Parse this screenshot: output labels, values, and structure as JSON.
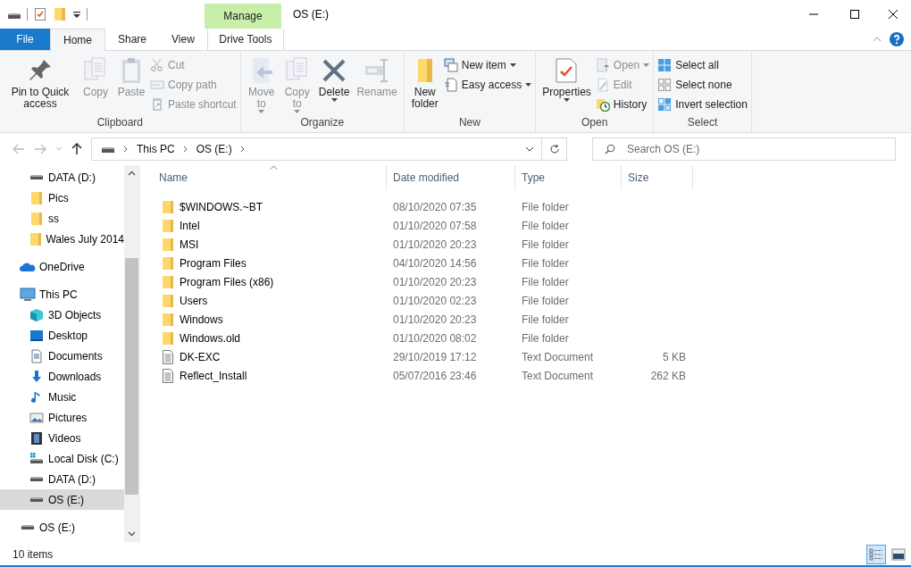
{
  "window": {
    "title": "OS (E:)",
    "contextual_group": "Manage"
  },
  "tabs": [
    {
      "label": "File",
      "kind": "file",
      "selected": false
    },
    {
      "label": "Home",
      "kind": "normal",
      "selected": true
    },
    {
      "label": "Share",
      "kind": "normal",
      "selected": false
    },
    {
      "label": "View",
      "kind": "normal",
      "selected": false
    },
    {
      "label": "Drive Tools",
      "kind": "contextual",
      "selected": false
    }
  ],
  "ribbon": [
    {
      "label": "Clipboard",
      "buttons": [
        {
          "kind": "large",
          "label": "Pin to Quick access",
          "disabled": false,
          "menu": false
        },
        {
          "kind": "large",
          "label": "Copy",
          "disabled": true,
          "menu": false
        },
        {
          "kind": "large",
          "label": "Paste",
          "disabled": true,
          "menu": false
        },
        {
          "kind": "small",
          "label": "Cut",
          "disabled": true,
          "menu": false
        },
        {
          "kind": "small",
          "label": "Copy path",
          "disabled": true,
          "menu": false
        },
        {
          "kind": "small",
          "label": "Paste shortcut",
          "disabled": true,
          "menu": false
        }
      ]
    },
    {
      "label": "Organize",
      "buttons": [
        {
          "kind": "large",
          "label": "Move to",
          "disabled": true,
          "menu": true
        },
        {
          "kind": "large",
          "label": "Copy to",
          "disabled": true,
          "menu": true
        },
        {
          "kind": "large",
          "label": "Delete",
          "disabled": false,
          "menu": true
        },
        {
          "kind": "large",
          "label": "Rename",
          "disabled": true,
          "menu": false
        }
      ]
    },
    {
      "label": "New",
      "buttons": [
        {
          "kind": "large",
          "label": "New folder",
          "disabled": false,
          "menu": false
        },
        {
          "kind": "small",
          "label": "New item",
          "disabled": false,
          "menu": true
        },
        {
          "kind": "small",
          "label": "Easy access",
          "disabled": false,
          "menu": true
        }
      ]
    },
    {
      "label": "Open",
      "buttons": [
        {
          "kind": "large",
          "label": "Properties",
          "disabled": false,
          "menu": true
        },
        {
          "kind": "small",
          "label": "Open",
          "disabled": true,
          "menu": true
        },
        {
          "kind": "small",
          "label": "Edit",
          "disabled": true,
          "menu": false
        },
        {
          "kind": "small",
          "label": "History",
          "disabled": false,
          "menu": false
        }
      ]
    },
    {
      "label": "Select",
      "buttons": [
        {
          "kind": "small",
          "label": "Select all",
          "disabled": false,
          "menu": false
        },
        {
          "kind": "small",
          "label": "Select none",
          "disabled": false,
          "menu": false
        },
        {
          "kind": "small",
          "label": "Invert selection",
          "disabled": false,
          "menu": false
        }
      ]
    }
  ],
  "address": {
    "path": [
      "This PC",
      "OS (E:)"
    ],
    "search_placeholder": "Search OS (E:)"
  },
  "nav": {
    "quick_access_items": [
      {
        "label": "DATA (D:)",
        "kind": "drive",
        "selected": false
      },
      {
        "label": "Pics",
        "kind": "folder",
        "selected": false
      },
      {
        "label": "ss",
        "kind": "folder",
        "selected": false
      },
      {
        "label": "Wales July 2014",
        "kind": "folder",
        "selected": false
      }
    ],
    "tree": [
      {
        "label": "OneDrive",
        "kind": "cloud",
        "selected": false
      },
      {
        "label": "This PC",
        "kind": "pc",
        "selected": false,
        "children": [
          {
            "label": "3D Objects",
            "kind": "cube",
            "selected": false
          },
          {
            "label": "Desktop",
            "kind": "desktop",
            "selected": false
          },
          {
            "label": "Documents",
            "kind": "documents",
            "selected": false
          },
          {
            "label": "Downloads",
            "kind": "downloads",
            "selected": false
          },
          {
            "label": "Music",
            "kind": "music",
            "selected": false
          },
          {
            "label": "Pictures",
            "kind": "pictures",
            "selected": false
          },
          {
            "label": "Videos",
            "kind": "videos",
            "selected": false
          },
          {
            "label": "Local Disk (C:)",
            "kind": "system_drive",
            "selected": false
          },
          {
            "label": "DATA (D:)",
            "kind": "drive",
            "selected": false
          },
          {
            "label": "OS (E:)",
            "kind": "drive",
            "selected": true
          }
        ]
      },
      {
        "label": "OS (E:)",
        "kind": "drive",
        "selected": false
      }
    ]
  },
  "table": {
    "columns": [
      {
        "label": "Name",
        "sorted": true
      },
      {
        "label": "Date modified",
        "sorted": false
      },
      {
        "label": "Type",
        "sorted": false
      },
      {
        "label": "Size",
        "sorted": false
      }
    ],
    "rows": [
      {
        "kind": "folder",
        "name": "$WINDOWS.~BT",
        "date": "08/10/2020 07:35",
        "type": "File folder"
      },
      {
        "kind": "folder",
        "name": "Intel",
        "date": "01/10/2020 07:58",
        "type": "File folder"
      },
      {
        "kind": "folder",
        "name": "MSI",
        "date": "01/10/2020 20:23",
        "type": "File folder"
      },
      {
        "kind": "folder",
        "name": "Program Files",
        "date": "04/10/2020 14:56",
        "type": "File folder"
      },
      {
        "kind": "folder",
        "name": "Program Files (x86)",
        "date": "01/10/2020 20:23",
        "type": "File folder"
      },
      {
        "kind": "folder",
        "name": "Users",
        "date": "01/10/2020 02:23",
        "type": "File folder"
      },
      {
        "kind": "folder",
        "name": "Windows",
        "date": "01/10/2020 20:23",
        "type": "File folder"
      },
      {
        "kind": "folder",
        "name": "Windows.old",
        "date": "01/10/2020 08:02",
        "type": "File folder"
      },
      {
        "kind": "document",
        "name": "DK-EXC",
        "date": "29/10/2019 17:12",
        "type": "Text Document",
        "size": "5 KB"
      },
      {
        "kind": "document",
        "name": "Reflect_Install",
        "date": "05/07/2016 23:46",
        "type": "Text Document",
        "size": "262 KB"
      }
    ]
  },
  "status_bar": {
    "text": "10 items",
    "views": [
      {
        "kind": "details",
        "selected": true
      },
      {
        "kind": "large_icons",
        "selected": false
      }
    ]
  }
}
